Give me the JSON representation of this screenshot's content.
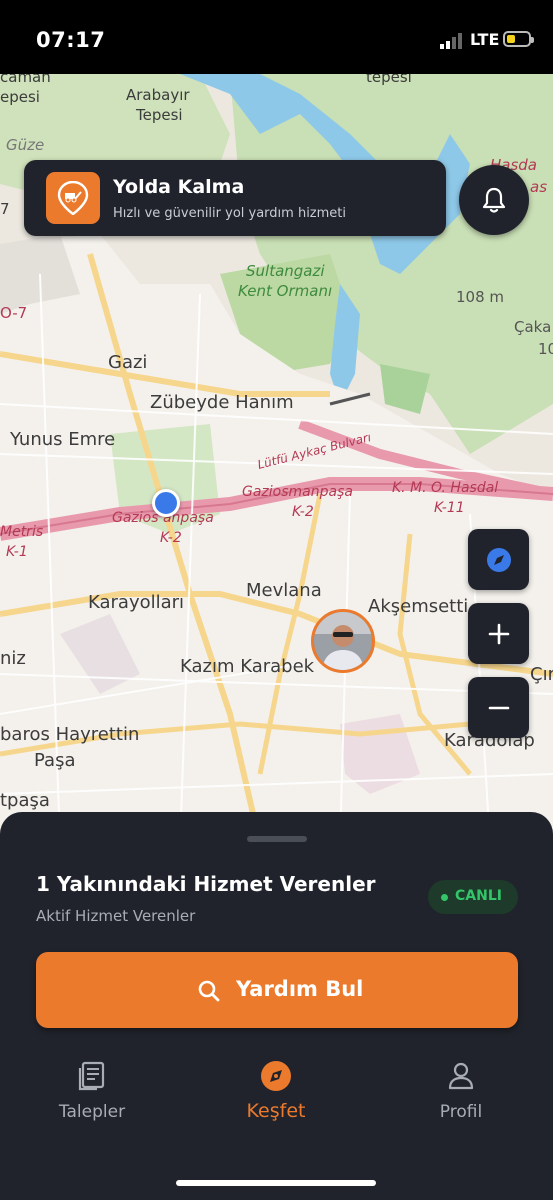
{
  "status_bar": {
    "time": "07:17",
    "network": "LTE",
    "battery_level": 0.3
  },
  "header": {
    "title": "Yolda Kalma",
    "subtitle": "Hızlı ve güvenilir yol yardım hizmeti",
    "logo_icon": "tow-truck-icon",
    "notification_icon": "bell-icon"
  },
  "map": {
    "labels": [
      "Arabayır",
      "Tepesi",
      "tepesi",
      "Sultangazi",
      "Kent Ormanı",
      "108 m",
      "Gazi",
      "Zübeyde Hanım",
      "Yunus Emre",
      "Lütfü Aykaç Bulvarı",
      "Gaziosmanpaşa",
      "K-2",
      "K. M. O. Hasdal",
      "K-11",
      "Metris",
      "K-1",
      "Gazios  anpaşa",
      "K-2",
      "Mevlana",
      "Karayolları",
      "Akşemsetti",
      "niz",
      "Kazım Karabek",
      "Çırçır",
      "baros Hayrettin",
      "Paşa",
      "Karadolap",
      "tpaşa",
      "Hasda",
      "as",
      "Çaka",
      "10",
      "O-7",
      "caman",
      "epesi",
      "Güze",
      "7"
    ]
  },
  "controls": {
    "compass_icon": "compass-icon",
    "zoom_in": "+",
    "zoom_out": "−"
  },
  "sheet": {
    "title": "1 Yakınındaki Hizmet Verenler",
    "subtitle": "Aktif Hizmet Verenler",
    "live_badge": "CANLI",
    "help_button": "Yardım Bul"
  },
  "tabs": [
    {
      "label": "Talepler",
      "icon": "receipt-icon",
      "active": false
    },
    {
      "label": "Keşfet",
      "icon": "compass-icon",
      "active": true
    },
    {
      "label": "Profil",
      "icon": "user-icon",
      "active": false
    }
  ],
  "colors": {
    "accent": "#ec7a2d",
    "surface": "#20232b",
    "live_green": "#34c46a",
    "user_dot": "#3a7ae8"
  }
}
